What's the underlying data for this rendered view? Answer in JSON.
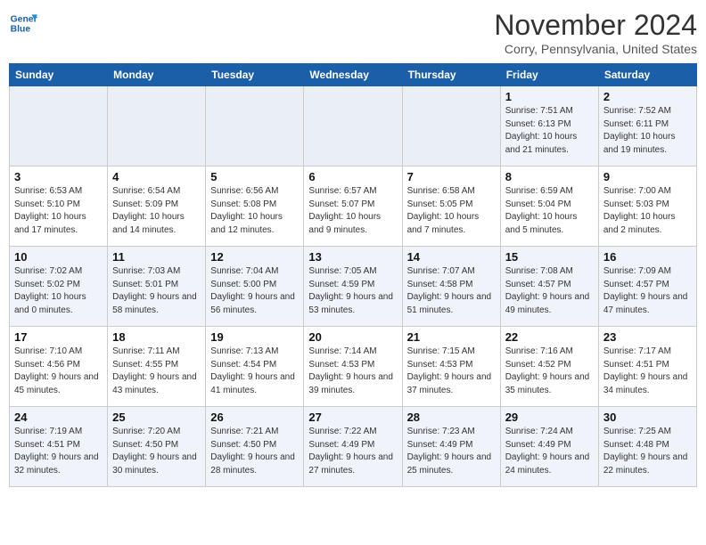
{
  "header": {
    "logo_line1": "General",
    "logo_line2": "Blue",
    "month": "November 2024",
    "location": "Corry, Pennsylvania, United States"
  },
  "weekdays": [
    "Sunday",
    "Monday",
    "Tuesday",
    "Wednesday",
    "Thursday",
    "Friday",
    "Saturday"
  ],
  "weeks": [
    [
      {
        "day": "",
        "info": ""
      },
      {
        "day": "",
        "info": ""
      },
      {
        "day": "",
        "info": ""
      },
      {
        "day": "",
        "info": ""
      },
      {
        "day": "",
        "info": ""
      },
      {
        "day": "1",
        "info": "Sunrise: 7:51 AM\nSunset: 6:13 PM\nDaylight: 10 hours and 21 minutes."
      },
      {
        "day": "2",
        "info": "Sunrise: 7:52 AM\nSunset: 6:11 PM\nDaylight: 10 hours and 19 minutes."
      }
    ],
    [
      {
        "day": "3",
        "info": "Sunrise: 6:53 AM\nSunset: 5:10 PM\nDaylight: 10 hours and 17 minutes."
      },
      {
        "day": "4",
        "info": "Sunrise: 6:54 AM\nSunset: 5:09 PM\nDaylight: 10 hours and 14 minutes."
      },
      {
        "day": "5",
        "info": "Sunrise: 6:56 AM\nSunset: 5:08 PM\nDaylight: 10 hours and 12 minutes."
      },
      {
        "day": "6",
        "info": "Sunrise: 6:57 AM\nSunset: 5:07 PM\nDaylight: 10 hours and 9 minutes."
      },
      {
        "day": "7",
        "info": "Sunrise: 6:58 AM\nSunset: 5:05 PM\nDaylight: 10 hours and 7 minutes."
      },
      {
        "day": "8",
        "info": "Sunrise: 6:59 AM\nSunset: 5:04 PM\nDaylight: 10 hours and 5 minutes."
      },
      {
        "day": "9",
        "info": "Sunrise: 7:00 AM\nSunset: 5:03 PM\nDaylight: 10 hours and 2 minutes."
      }
    ],
    [
      {
        "day": "10",
        "info": "Sunrise: 7:02 AM\nSunset: 5:02 PM\nDaylight: 10 hours and 0 minutes."
      },
      {
        "day": "11",
        "info": "Sunrise: 7:03 AM\nSunset: 5:01 PM\nDaylight: 9 hours and 58 minutes."
      },
      {
        "day": "12",
        "info": "Sunrise: 7:04 AM\nSunset: 5:00 PM\nDaylight: 9 hours and 56 minutes."
      },
      {
        "day": "13",
        "info": "Sunrise: 7:05 AM\nSunset: 4:59 PM\nDaylight: 9 hours and 53 minutes."
      },
      {
        "day": "14",
        "info": "Sunrise: 7:07 AM\nSunset: 4:58 PM\nDaylight: 9 hours and 51 minutes."
      },
      {
        "day": "15",
        "info": "Sunrise: 7:08 AM\nSunset: 4:57 PM\nDaylight: 9 hours and 49 minutes."
      },
      {
        "day": "16",
        "info": "Sunrise: 7:09 AM\nSunset: 4:57 PM\nDaylight: 9 hours and 47 minutes."
      }
    ],
    [
      {
        "day": "17",
        "info": "Sunrise: 7:10 AM\nSunset: 4:56 PM\nDaylight: 9 hours and 45 minutes."
      },
      {
        "day": "18",
        "info": "Sunrise: 7:11 AM\nSunset: 4:55 PM\nDaylight: 9 hours and 43 minutes."
      },
      {
        "day": "19",
        "info": "Sunrise: 7:13 AM\nSunset: 4:54 PM\nDaylight: 9 hours and 41 minutes."
      },
      {
        "day": "20",
        "info": "Sunrise: 7:14 AM\nSunset: 4:53 PM\nDaylight: 9 hours and 39 minutes."
      },
      {
        "day": "21",
        "info": "Sunrise: 7:15 AM\nSunset: 4:53 PM\nDaylight: 9 hours and 37 minutes."
      },
      {
        "day": "22",
        "info": "Sunrise: 7:16 AM\nSunset: 4:52 PM\nDaylight: 9 hours and 35 minutes."
      },
      {
        "day": "23",
        "info": "Sunrise: 7:17 AM\nSunset: 4:51 PM\nDaylight: 9 hours and 34 minutes."
      }
    ],
    [
      {
        "day": "24",
        "info": "Sunrise: 7:19 AM\nSunset: 4:51 PM\nDaylight: 9 hours and 32 minutes."
      },
      {
        "day": "25",
        "info": "Sunrise: 7:20 AM\nSunset: 4:50 PM\nDaylight: 9 hours and 30 minutes."
      },
      {
        "day": "26",
        "info": "Sunrise: 7:21 AM\nSunset: 4:50 PM\nDaylight: 9 hours and 28 minutes."
      },
      {
        "day": "27",
        "info": "Sunrise: 7:22 AM\nSunset: 4:49 PM\nDaylight: 9 hours and 27 minutes."
      },
      {
        "day": "28",
        "info": "Sunrise: 7:23 AM\nSunset: 4:49 PM\nDaylight: 9 hours and 25 minutes."
      },
      {
        "day": "29",
        "info": "Sunrise: 7:24 AM\nSunset: 4:49 PM\nDaylight: 9 hours and 24 minutes."
      },
      {
        "day": "30",
        "info": "Sunrise: 7:25 AM\nSunset: 4:48 PM\nDaylight: 9 hours and 22 minutes."
      }
    ]
  ]
}
